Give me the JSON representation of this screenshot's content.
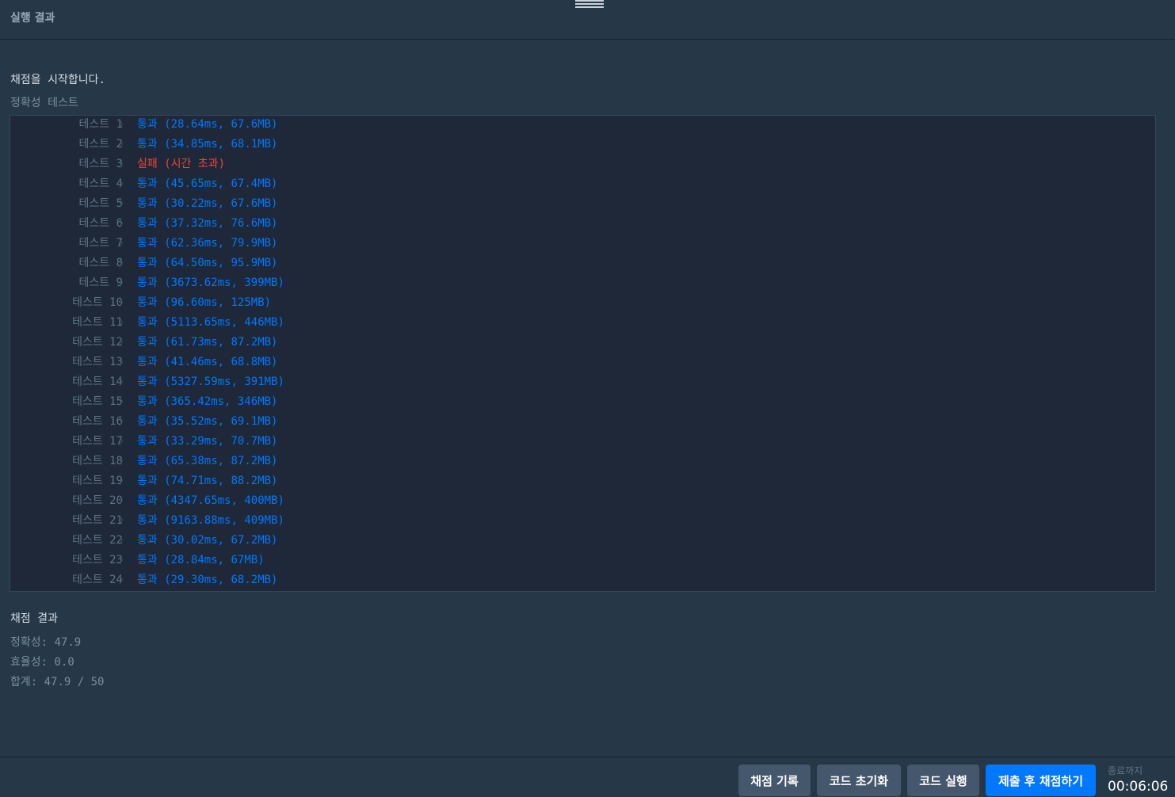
{
  "header": {
    "title": "실행 결과"
  },
  "console": {
    "start_message": "채점을 시작합니다.",
    "section_title": "정확성  테스트",
    "arrow_glyph": "〉",
    "results": [
      {
        "label": "테스트 1",
        "status": "통과 (28.64ms, 67.6MB)",
        "passed": true
      },
      {
        "label": "테스트 2",
        "status": "통과 (34.85ms, 68.1MB)",
        "passed": true
      },
      {
        "label": "테스트 3",
        "status": "실패 (시간 초과)",
        "passed": false
      },
      {
        "label": "테스트 4",
        "status": "통과 (45.65ms, 67.4MB)",
        "passed": true
      },
      {
        "label": "테스트 5",
        "status": "통과 (30.22ms, 67.6MB)",
        "passed": true
      },
      {
        "label": "테스트 6",
        "status": "통과 (37.32ms, 76.6MB)",
        "passed": true
      },
      {
        "label": "테스트 7",
        "status": "통과 (62.36ms, 79.9MB)",
        "passed": true
      },
      {
        "label": "테스트 8",
        "status": "통과 (64.50ms, 95.9MB)",
        "passed": true
      },
      {
        "label": "테스트 9",
        "status": "통과 (3673.62ms, 399MB)",
        "passed": true
      },
      {
        "label": "테스트 10",
        "status": "통과 (96.60ms, 125MB)",
        "passed": true
      },
      {
        "label": "테스트 11",
        "status": "통과 (5113.65ms, 446MB)",
        "passed": true
      },
      {
        "label": "테스트 12",
        "status": "통과 (61.73ms, 87.2MB)",
        "passed": true
      },
      {
        "label": "테스트 13",
        "status": "통과 (41.46ms, 68.8MB)",
        "passed": true
      },
      {
        "label": "테스트 14",
        "status": "통과 (5327.59ms, 391MB)",
        "passed": true
      },
      {
        "label": "테스트 15",
        "status": "통과 (365.42ms, 346MB)",
        "passed": true
      },
      {
        "label": "테스트 16",
        "status": "통과 (35.52ms, 69.1MB)",
        "passed": true
      },
      {
        "label": "테스트 17",
        "status": "통과 (33.29ms, 70.7MB)",
        "passed": true
      },
      {
        "label": "테스트 18",
        "status": "통과 (65.38ms, 87.2MB)",
        "passed": true
      },
      {
        "label": "테스트 19",
        "status": "통과 (74.71ms, 88.2MB)",
        "passed": true
      },
      {
        "label": "테스트 20",
        "status": "통과 (4347.65ms, 400MB)",
        "passed": true
      },
      {
        "label": "테스트 21",
        "status": "통과 (9163.88ms, 409MB)",
        "passed": true
      },
      {
        "label": "테스트 22",
        "status": "통과 (30.02ms, 67.2MB)",
        "passed": true
      },
      {
        "label": "테스트 23",
        "status": "통과 (28.84ms, 67MB)",
        "passed": true
      },
      {
        "label": "테스트 24",
        "status": "통과 (29.30ms, 68.2MB)",
        "passed": true
      }
    ],
    "score_title": "채점 결과",
    "score_lines": [
      "정확성: 47.9",
      "효율성: 0.0",
      "합계: 47.9 / 50"
    ]
  },
  "footer": {
    "history_button": "채점 기록",
    "reset_button": "코드 초기화",
    "run_button": "코드 실행",
    "submit_button": "제출 후 채점하기",
    "timer_label": "종료까지",
    "timer_value": "00:06:06"
  },
  "colors": {
    "background": "#263747",
    "pass": "#0078ff",
    "fail": "#f44336",
    "primary_button": "#0078ff",
    "secondary_button": "#44576c"
  }
}
